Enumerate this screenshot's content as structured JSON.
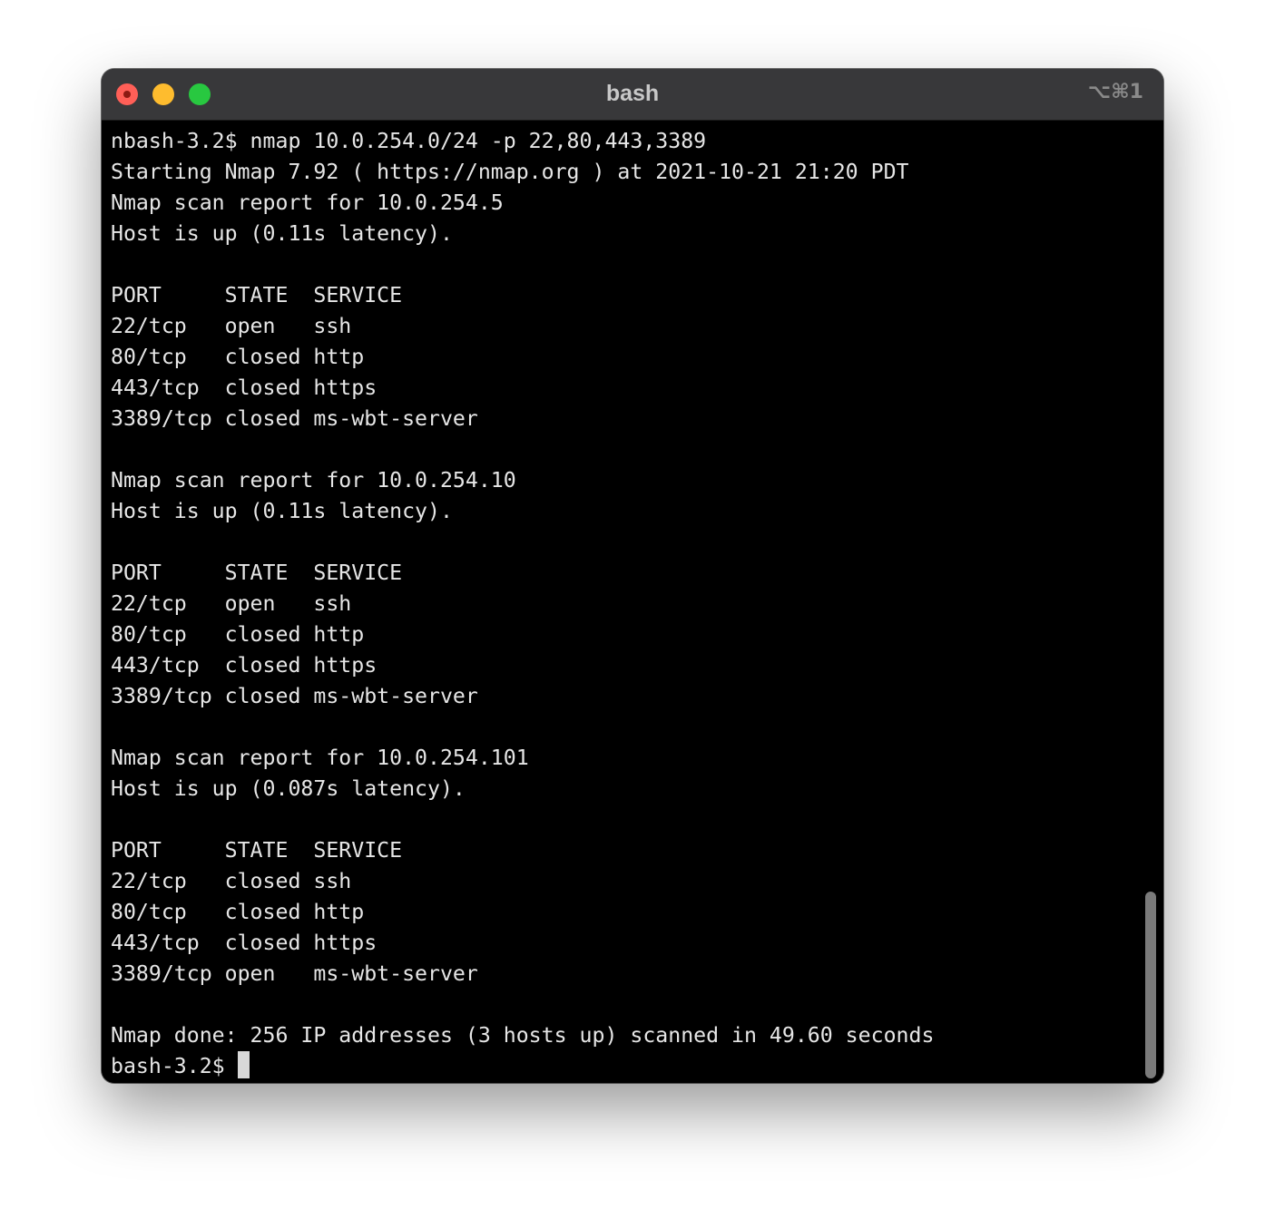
{
  "window": {
    "title": "bash",
    "shortcut": "⌥⌘1",
    "buttons": {
      "close": "close",
      "minimize": "minimize",
      "zoom": "zoom"
    }
  },
  "terminal": {
    "lines": [
      "nbash-3.2$ nmap 10.0.254.0/24 -p 22,80,443,3389",
      "Starting Nmap 7.92 ( https://nmap.org ) at 2021-10-21 21:20 PDT",
      "Nmap scan report for 10.0.254.5",
      "Host is up (0.11s latency).",
      "",
      "PORT     STATE  SERVICE",
      "22/tcp   open   ssh",
      "80/tcp   closed http",
      "443/tcp  closed https",
      "3389/tcp closed ms-wbt-server",
      "",
      "Nmap scan report for 10.0.254.10",
      "Host is up (0.11s latency).",
      "",
      "PORT     STATE  SERVICE",
      "22/tcp   open   ssh",
      "80/tcp   closed http",
      "443/tcp  closed https",
      "3389/tcp closed ms-wbt-server",
      "",
      "Nmap scan report for 10.0.254.101",
      "Host is up (0.087s latency).",
      "",
      "PORT     STATE  SERVICE",
      "22/tcp   closed ssh",
      "80/tcp   closed http",
      "443/tcp  closed https",
      "3389/tcp open   ms-wbt-server",
      "",
      "Nmap done: 256 IP addresses (3 hosts up) scanned in 49.60 seconds"
    ],
    "prompt": "bash-3.2$ "
  },
  "colors": {
    "background": "#000000",
    "foreground": "#e6e6e6",
    "titlebar": "#38383a",
    "close": "#ff5f57",
    "minimize": "#febc2e",
    "zoom": "#28c840"
  }
}
